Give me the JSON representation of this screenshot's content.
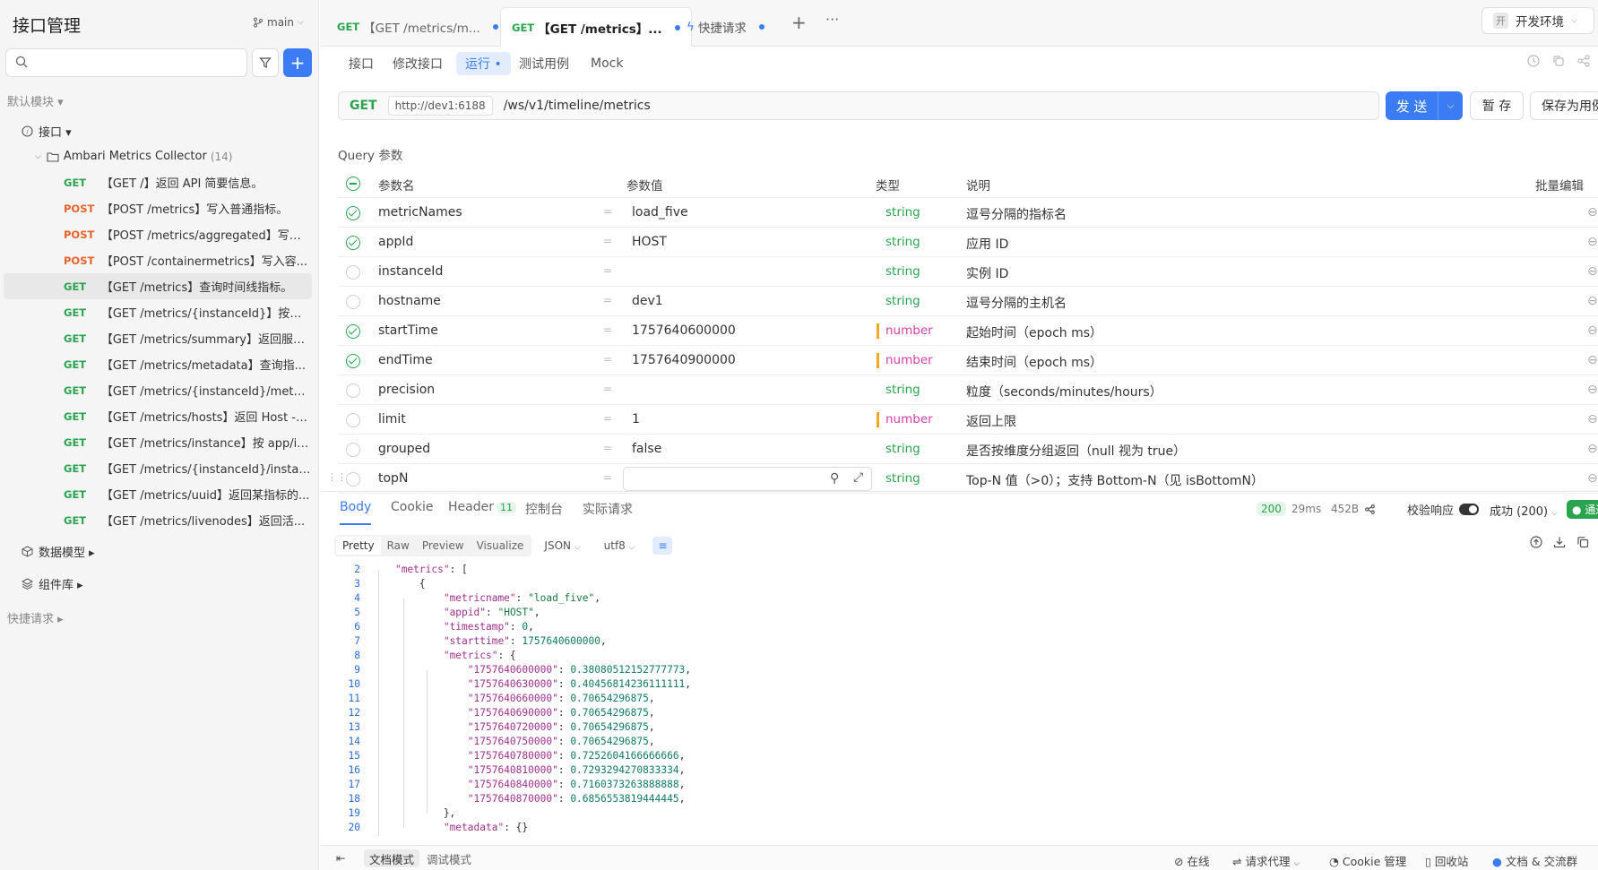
{
  "sidebar": {
    "title": "接口管理",
    "branch": "main",
    "search_placeholder": "",
    "default_module": "默认模块 ▾",
    "api_group": "接口 ▾",
    "folder_name": "Ambari Metrics Collector",
    "folder_count": "(14)",
    "items": [
      {
        "method": "GET",
        "name": "【GET /】返回 API 简要信息。"
      },
      {
        "method": "POST",
        "name": "【POST /metrics】写入普通指标。"
      },
      {
        "method": "POST",
        "name": "【POST /metrics/aggregated】写入..."
      },
      {
        "method": "POST",
        "name": "【POST /containermetrics】写入容..."
      },
      {
        "method": "GET",
        "name": "【GET /metrics】查询时间线指标。"
      },
      {
        "method": "GET",
        "name": "【GET /metrics/{instanceId}】按实..."
      },
      {
        "method": "GET",
        "name": "【GET /metrics/summary】返回服务..."
      },
      {
        "method": "GET",
        "name": "【GET /metrics/metadata】查询指..."
      },
      {
        "method": "GET",
        "name": "【GET /metrics/{instanceId}/metada..."
      },
      {
        "method": "GET",
        "name": "【GET /metrics/hosts】返回 Host ->..."
      },
      {
        "method": "GET",
        "name": "【GET /metrics/instance】按 app/in..."
      },
      {
        "method": "GET",
        "name": "【GET /metrics/{instanceId}/instanc..."
      },
      {
        "method": "GET",
        "name": "【GET /metrics/uuid】返回某指标的..."
      },
      {
        "method": "GET",
        "name": "【GET /metrics/livenodes】返回活..."
      }
    ],
    "data_model": "数据模型 ▸",
    "component_lib": "组件库 ▸",
    "quick_request": "快捷请求 ▸"
  },
  "tabs": [
    {
      "method": "GET",
      "label": "【GET /metrics/m..."
    },
    {
      "method": "GET",
      "label": "【GET /metrics】..."
    },
    {
      "method": "",
      "label": "快捷请求"
    }
  ],
  "env": {
    "badge": "开",
    "label": "开发环境"
  },
  "subtabs": [
    "接口",
    "修改接口",
    "运行 •",
    "测试用例",
    "Mock"
  ],
  "request": {
    "method": "GET",
    "host": "http://dev1:6188",
    "path": "/ws/v1/timeline/metrics",
    "send_label": "发 送",
    "save_draft": "暂 存",
    "save_case": "保存为用例"
  },
  "query": {
    "title": "Query 参数",
    "headers": {
      "name": "参数名",
      "value": "参数值",
      "type": "类型",
      "desc": "说明",
      "bulk": "批量编辑"
    },
    "rows": [
      {
        "checked": true,
        "name": "metricNames",
        "value": "load_five",
        "type": "string",
        "desc": "逗号分隔的指标名"
      },
      {
        "checked": true,
        "name": "appId",
        "value": "HOST",
        "type": "string",
        "desc": "应用 ID"
      },
      {
        "checked": false,
        "name": "instanceId",
        "value": "",
        "type": "string",
        "desc": "实例 ID"
      },
      {
        "checked": false,
        "name": "hostname",
        "value": "dev1",
        "type": "string",
        "desc": "逗号分隔的主机名"
      },
      {
        "checked": true,
        "name": "startTime",
        "value": "1757640600000",
        "type": "number",
        "desc": "起始时间（epoch ms）"
      },
      {
        "checked": true,
        "name": "endTime",
        "value": "1757640900000",
        "type": "number",
        "desc": "结束时间（epoch ms）"
      },
      {
        "checked": false,
        "name": "precision",
        "value": "",
        "type": "string",
        "desc": "粒度（seconds/minutes/hours）"
      },
      {
        "checked": false,
        "name": "limit",
        "value": "1",
        "type": "number",
        "desc": "返回上限"
      },
      {
        "checked": false,
        "name": "grouped",
        "value": "false",
        "type": "string",
        "desc": "是否按维度分组返回（null 视为 true）"
      },
      {
        "checked": false,
        "name": "topN",
        "value": "",
        "type": "string",
        "desc": "Top-N 值（>0）；支持 Bottom-N（见 isBottomN）"
      }
    ]
  },
  "response": {
    "tabs": [
      "Body",
      "Cookie",
      "Header",
      "控制台",
      "实际请求"
    ],
    "header_count": "11",
    "status": "200",
    "time": "29ms",
    "size": "452B",
    "verify_label": "校验响应",
    "success_label": "成功 (200)",
    "pass_label": "通过",
    "formats": [
      "Pretty",
      "Raw",
      "Preview",
      "Visualize"
    ],
    "content_type": "JSON",
    "encoding": "utf8",
    "code_lines": [
      {
        "no": "2",
        "text": "    \"metrics\": ["
      },
      {
        "no": "3",
        "text": "        {"
      },
      {
        "no": "4",
        "text": "            \"metricname\": \"load_five\","
      },
      {
        "no": "5",
        "text": "            \"appid\": \"HOST\","
      },
      {
        "no": "6",
        "text": "            \"timestamp\": 0,"
      },
      {
        "no": "7",
        "text": "            \"starttime\": 1757640600000,"
      },
      {
        "no": "8",
        "text": "            \"metrics\": {"
      },
      {
        "no": "9",
        "text": "                \"1757640600000\": 0.38080512152777773,"
      },
      {
        "no": "10",
        "text": "                \"1757640630000\": 0.40456814236111111,"
      },
      {
        "no": "11",
        "text": "                \"1757640660000\": 0.70654296875,"
      },
      {
        "no": "12",
        "text": "                \"1757640690000\": 0.70654296875,"
      },
      {
        "no": "13",
        "text": "                \"1757640720000\": 0.70654296875,"
      },
      {
        "no": "14",
        "text": "                \"1757640750000\": 0.70654296875,"
      },
      {
        "no": "15",
        "text": "                \"1757640780000\": 0.7252604166666666,"
      },
      {
        "no": "16",
        "text": "                \"1757640810000\": 0.7293294270833334,"
      },
      {
        "no": "17",
        "text": "                \"1757640840000\": 0.7160373263888888,"
      },
      {
        "no": "18",
        "text": "                \"1757640870000\": 0.6856553819444445,"
      },
      {
        "no": "19",
        "text": "            },"
      },
      {
        "no": "20",
        "text": "            \"metadata\": {}"
      }
    ]
  },
  "statusbar": {
    "doc_mode": "文档模式",
    "debug_mode": "调试模式",
    "online": "在线",
    "proxy": "请求代理",
    "cookie": "Cookie 管理",
    "recycle": "回收站",
    "docs": "文档 & 交流群"
  }
}
